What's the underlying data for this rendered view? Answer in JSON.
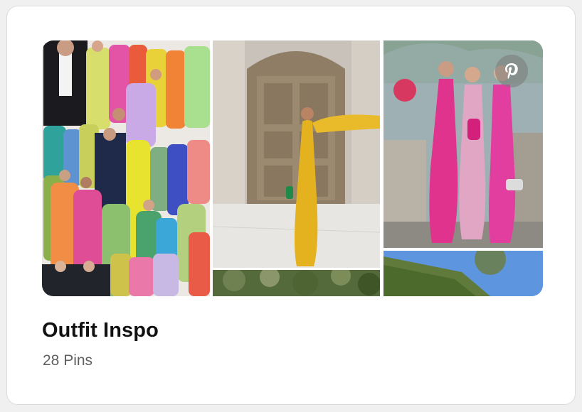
{
  "board": {
    "title": "Outfit Inspo",
    "pin_count": "28 Pins"
  },
  "collage": {
    "tiles": [
      {
        "name": "tile-bridesmaids-collage",
        "description": "colorful gowns collage"
      },
      {
        "name": "tile-yellow-gown-door",
        "description": "yellow gown by wooden door"
      },
      {
        "name": "tile-pink-dresses-trio",
        "description": "three women in pink dresses"
      },
      {
        "name": "tile-tree-canopy",
        "description": "tree foliage"
      },
      {
        "name": "tile-hedge-sky",
        "description": "hedge and blue sky"
      }
    ],
    "badge_icon": "pinterest-logo-icon"
  },
  "colors": {
    "title": "#111111",
    "subtitle": "#5f5f5f",
    "card_bg": "#ffffff",
    "page_bg": "#f0f0f0"
  }
}
